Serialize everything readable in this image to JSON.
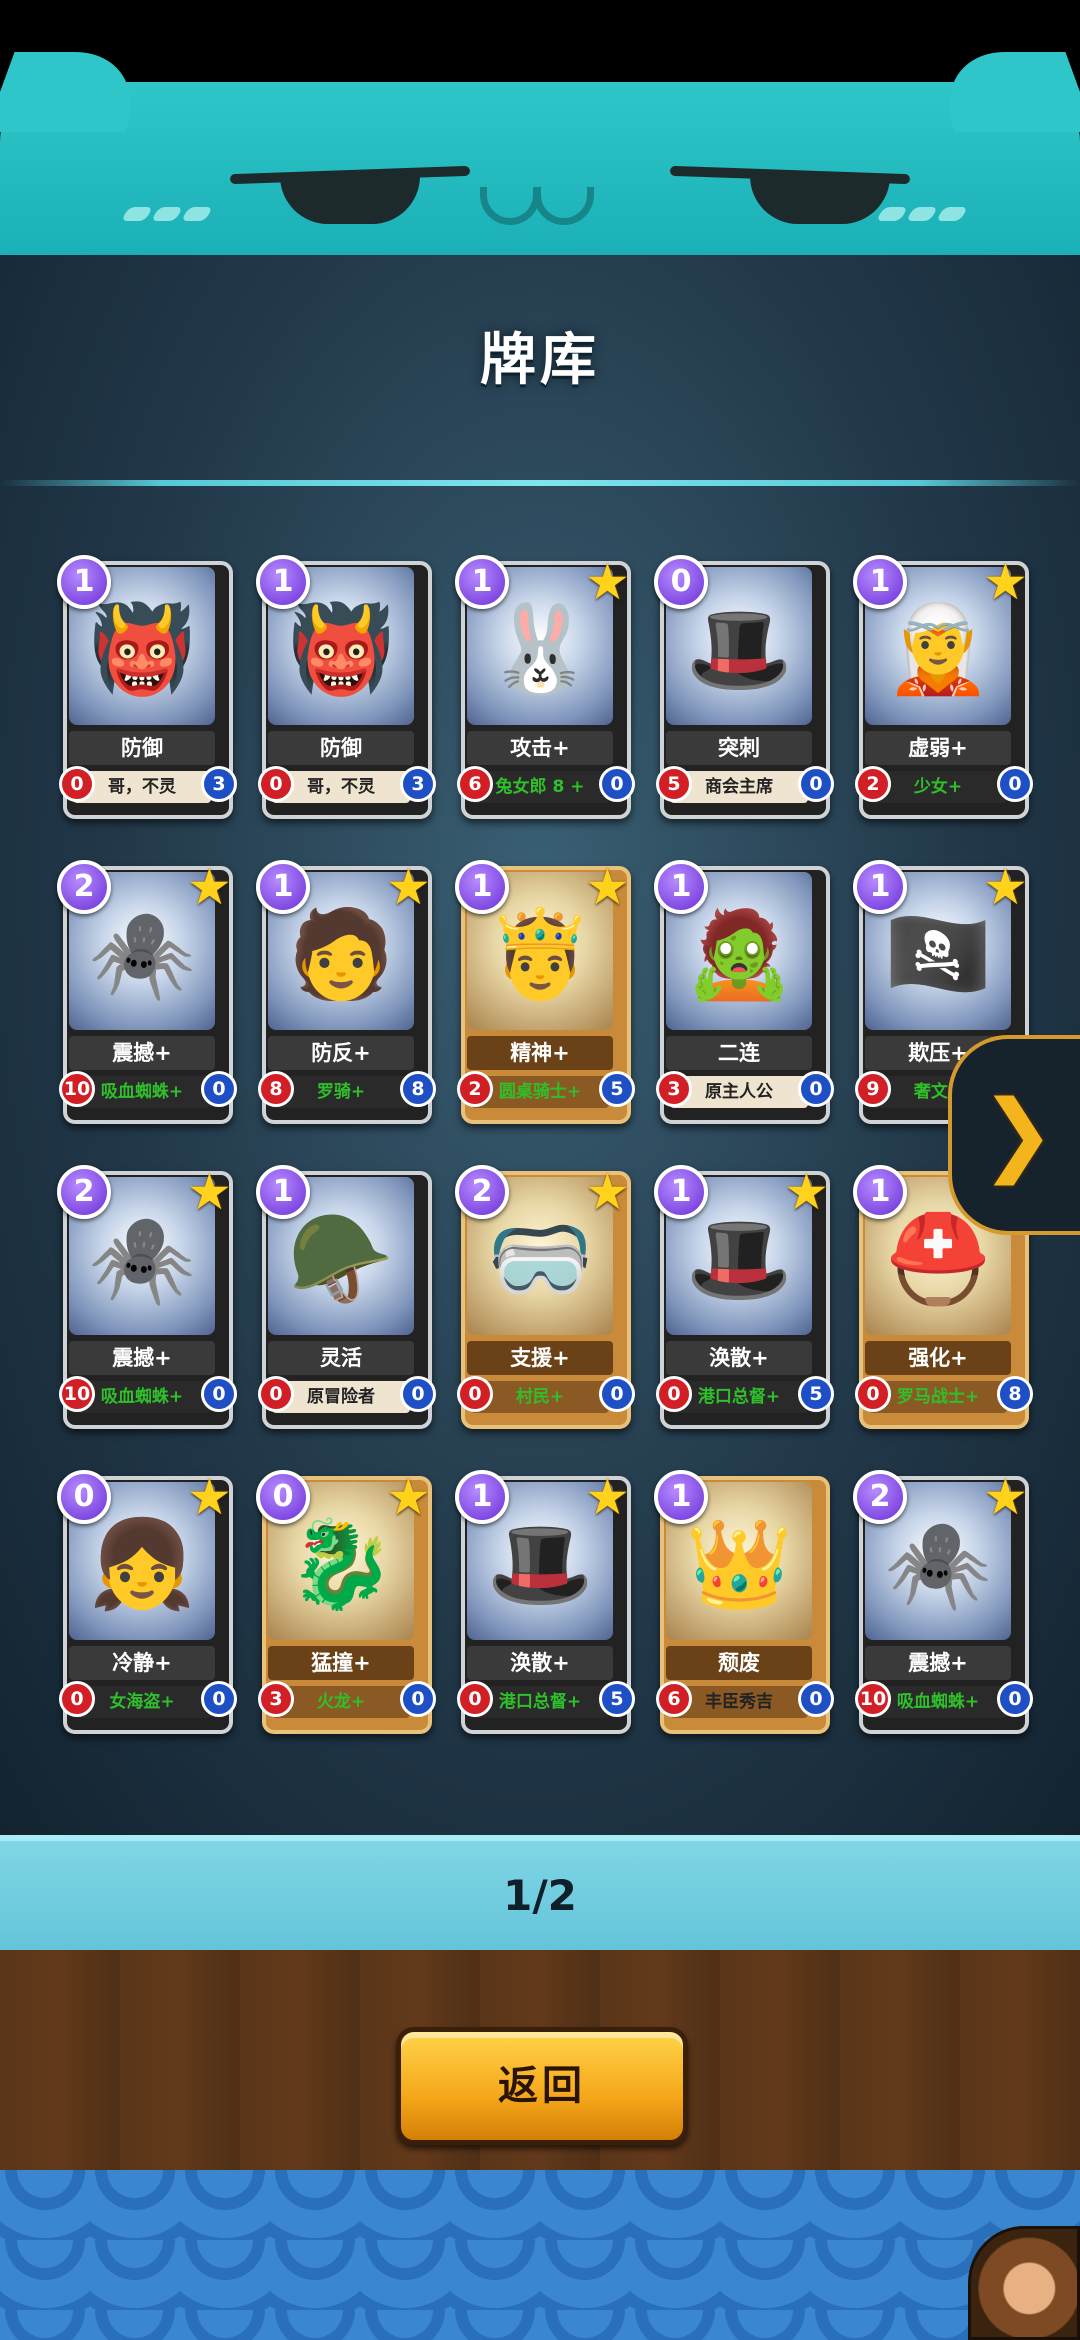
{
  "title": "牌库",
  "page_indicator": "1/2",
  "back_label": "返回",
  "icons": {
    "star": "★",
    "next": "❯"
  },
  "cards": [
    {
      "cost": "1",
      "name": "防御",
      "owner": "哥，不灵",
      "left": "0",
      "right": "3",
      "starred": false,
      "gold": false,
      "green": false,
      "art": "👹"
    },
    {
      "cost": "1",
      "name": "防御",
      "owner": "哥，不灵",
      "left": "0",
      "right": "3",
      "starred": false,
      "gold": false,
      "green": false,
      "art": "👹"
    },
    {
      "cost": "1",
      "name": "攻击+",
      "owner": "兔女郎 8 +",
      "left": "6",
      "right": "0",
      "starred": true,
      "gold": false,
      "green": true,
      "art": "🐰"
    },
    {
      "cost": "0",
      "name": "突刺",
      "owner": "商会主席",
      "left": "5",
      "right": "0",
      "starred": false,
      "gold": false,
      "green": false,
      "art": "🎩"
    },
    {
      "cost": "1",
      "name": "虚弱+",
      "owner": "少女+",
      "left": "2",
      "right": "0",
      "starred": true,
      "gold": false,
      "green": true,
      "art": "🧝"
    },
    {
      "cost": "2",
      "name": "震撼+",
      "owner": "吸血蜘蛛+",
      "left": "10",
      "right": "0",
      "starred": true,
      "gold": false,
      "green": true,
      "art": "🕷️"
    },
    {
      "cost": "1",
      "name": "防反+",
      "owner": "罗骑+",
      "left": "8",
      "right": "8",
      "starred": true,
      "gold": false,
      "green": true,
      "art": "🧑"
    },
    {
      "cost": "1",
      "name": "精神+",
      "owner": "圆桌骑士+",
      "left": "2",
      "right": "5",
      "starred": true,
      "gold": true,
      "green": true,
      "art": "🤴"
    },
    {
      "cost": "1",
      "name": "二连",
      "owner": "原主人公",
      "left": "3",
      "right": "0",
      "starred": false,
      "gold": false,
      "green": false,
      "art": "🧟"
    },
    {
      "cost": "1",
      "name": "欺压+",
      "owner": "奢文+",
      "left": "9",
      "right": "0",
      "starred": true,
      "gold": false,
      "green": true,
      "art": "🏴‍☠️"
    },
    {
      "cost": "2",
      "name": "震撼+",
      "owner": "吸血蜘蛛+",
      "left": "10",
      "right": "0",
      "starred": true,
      "gold": false,
      "green": true,
      "art": "🕷️"
    },
    {
      "cost": "1",
      "name": "灵活",
      "owner": "原冒险者",
      "left": "0",
      "right": "0",
      "starred": false,
      "gold": false,
      "green": false,
      "art": "🪖"
    },
    {
      "cost": "2",
      "name": "支援+",
      "owner": "村民+",
      "left": "0",
      "right": "0",
      "starred": true,
      "gold": true,
      "green": true,
      "art": "🥽"
    },
    {
      "cost": "1",
      "name": "涣散+",
      "owner": "港口总督+",
      "left": "0",
      "right": "5",
      "starred": true,
      "gold": false,
      "green": true,
      "art": "🎩"
    },
    {
      "cost": "1",
      "name": "强化+",
      "owner": "罗马战士+",
      "left": "0",
      "right": "8",
      "starred": true,
      "gold": true,
      "green": true,
      "art": "⛑️"
    },
    {
      "cost": "0",
      "name": "冷静+",
      "owner": "女海盗+",
      "left": "0",
      "right": "0",
      "starred": true,
      "gold": false,
      "green": true,
      "art": "👧"
    },
    {
      "cost": "0",
      "name": "猛撞+",
      "owner": "火龙+",
      "left": "3",
      "right": "0",
      "starred": true,
      "gold": true,
      "green": true,
      "art": "🐉"
    },
    {
      "cost": "1",
      "name": "涣散+",
      "owner": "港口总督+",
      "left": "0",
      "right": "5",
      "starred": true,
      "gold": false,
      "green": true,
      "art": "🎩"
    },
    {
      "cost": "1",
      "name": "颓废",
      "owner": "丰臣秀吉",
      "left": "6",
      "right": "0",
      "starred": false,
      "gold": true,
      "green": false,
      "art": "👑"
    },
    {
      "cost": "2",
      "name": "震撼+",
      "owner": "吸血蜘蛛+",
      "left": "10",
      "right": "0",
      "starred": true,
      "gold": false,
      "green": true,
      "art": "🕷️"
    }
  ]
}
